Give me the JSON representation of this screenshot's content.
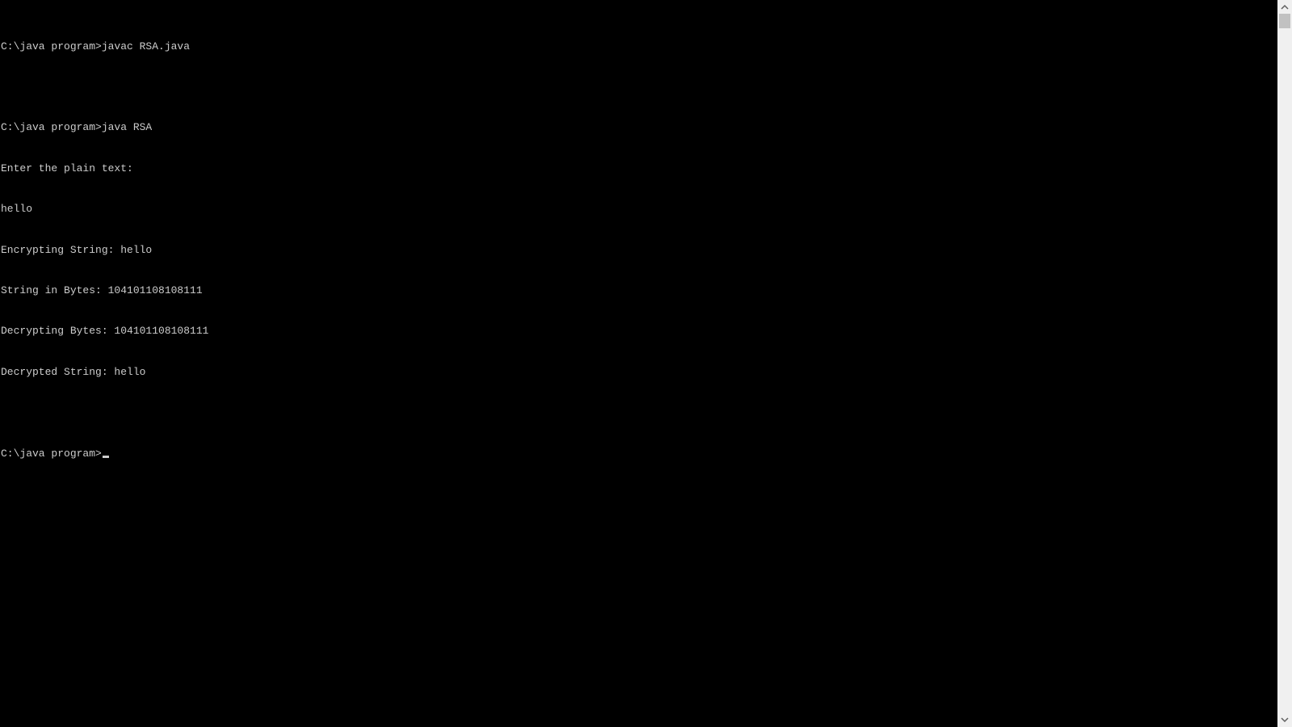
{
  "terminal": {
    "lines": [
      "",
      "C:\\java program>javac RSA.java",
      "",
      "C:\\java program>java RSA",
      "Enter the plain text:",
      "hello",
      "Encrypting String: hello",
      "String in Bytes: 104101108108111",
      "Decrypting Bytes: 104101108108111",
      "Decrypted String: hello",
      "",
      "C:\\java program>"
    ]
  },
  "colors": {
    "background": "#000000",
    "text": "#cccccc",
    "scrollbar_track": "#f0f0f0",
    "scrollbar_thumb": "#c1c1c1"
  },
  "icons": {
    "scroll_up": "chevron-up-icon",
    "scroll_down": "chevron-down-icon"
  }
}
